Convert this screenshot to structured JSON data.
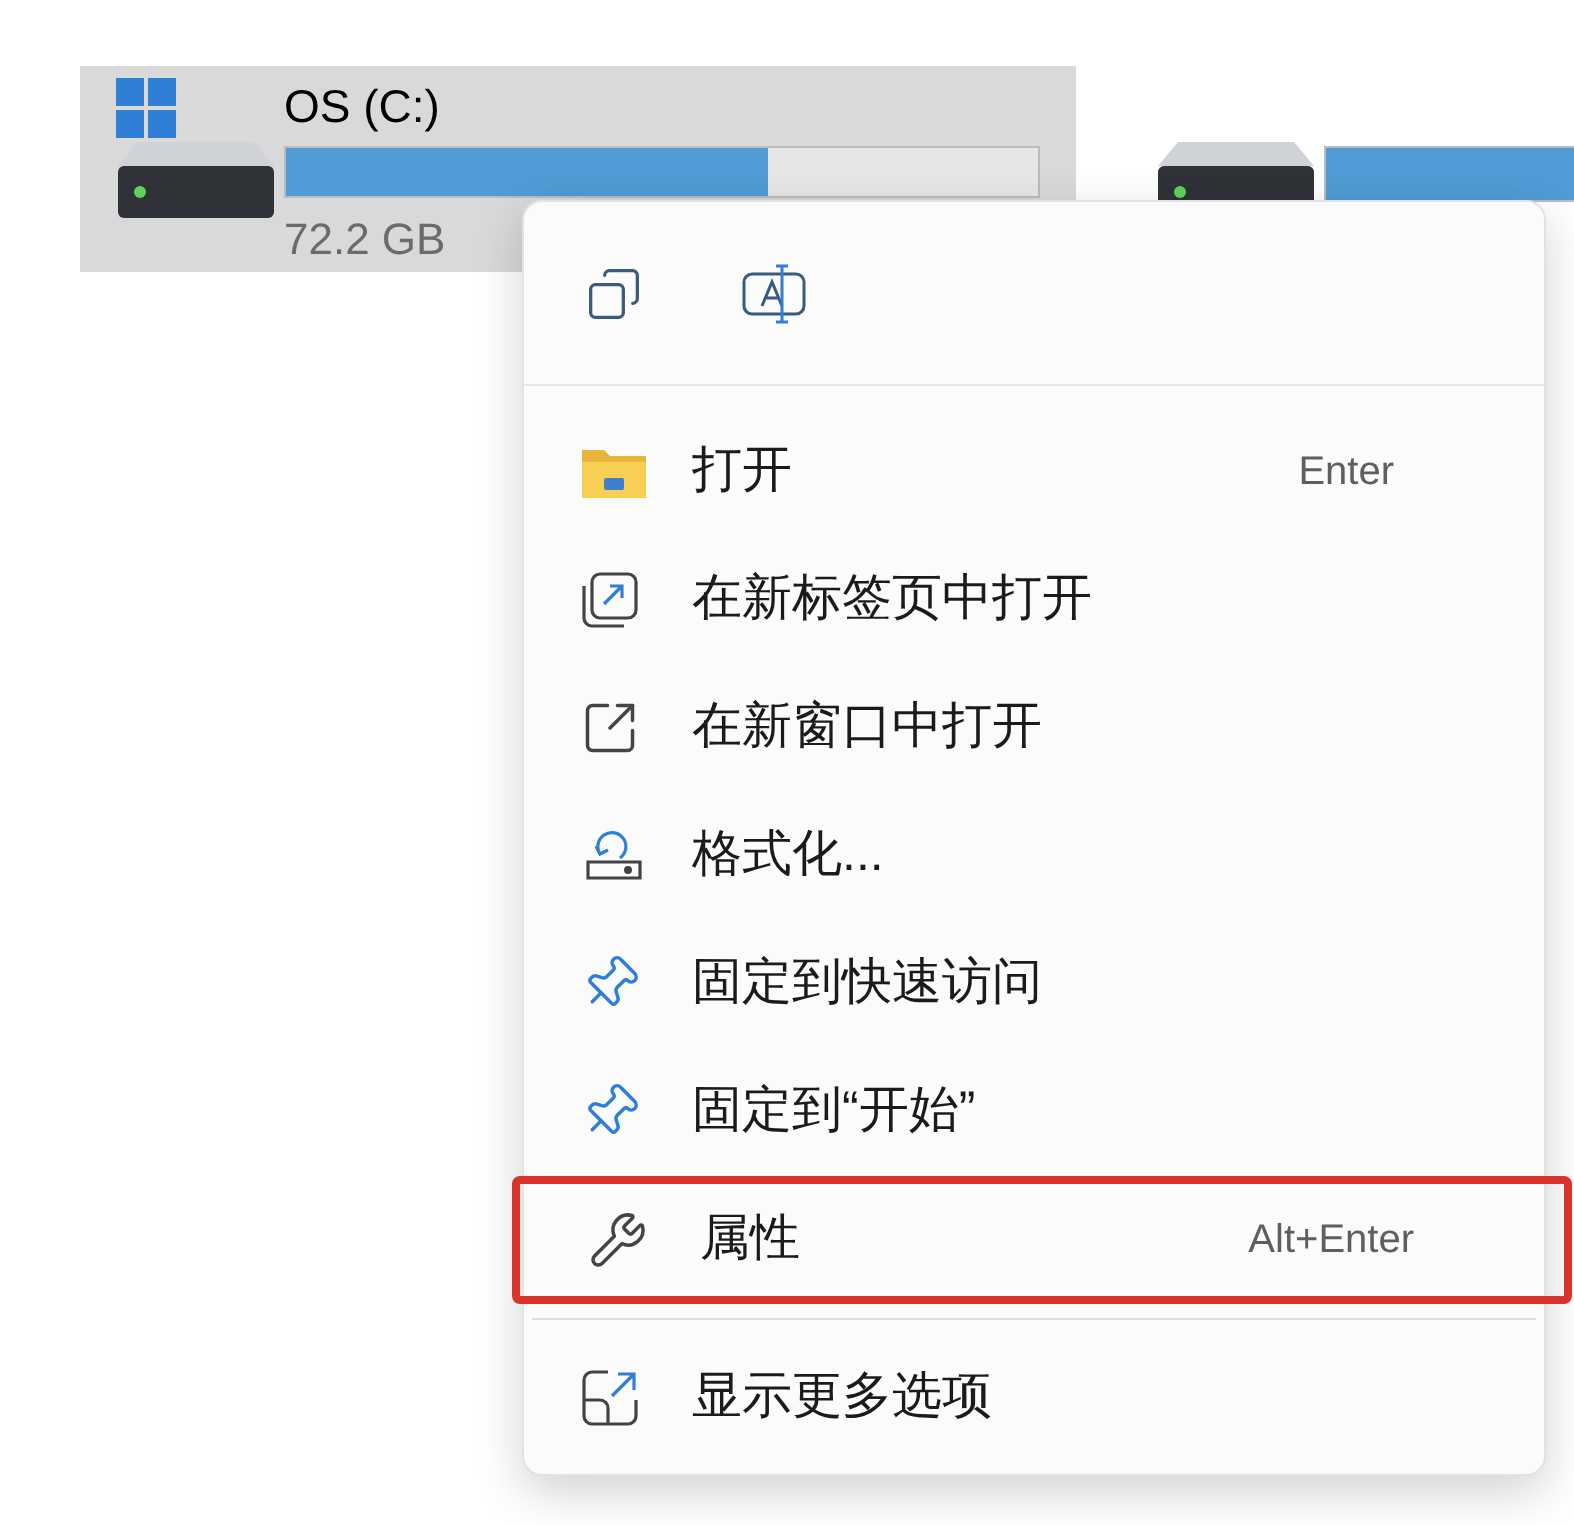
{
  "drives": [
    {
      "name": "OS (C:)",
      "level": 0.64,
      "free": "72.2 GB",
      "windows_logo": true
    },
    {
      "windows_logo": false
    }
  ],
  "context_menu": {
    "toolbar": [
      {
        "kind": "copy"
      },
      {
        "kind": "rename"
      }
    ],
    "items": [
      {
        "kind": "folder",
        "label": "打开",
        "shortcut": "Enter",
        "highlighted": false
      },
      {
        "kind": "new-tab",
        "label": "在新标签页中打开",
        "highlighted": false
      },
      {
        "kind": "new-window",
        "label": "在新窗口中打开",
        "highlighted": false
      },
      {
        "kind": "format",
        "label": "格式化...",
        "highlighted": false
      },
      {
        "kind": "pin",
        "label": "固定到快速访问",
        "highlighted": false
      },
      {
        "kind": "pin",
        "label": "固定到“开始”",
        "highlighted": false
      },
      {
        "kind": "properties",
        "label": "属性",
        "shortcut": "Alt+Enter",
        "highlighted": true
      },
      {
        "kind": "more",
        "label": "显示更多选项",
        "highlighted": false,
        "separated": true
      }
    ]
  }
}
